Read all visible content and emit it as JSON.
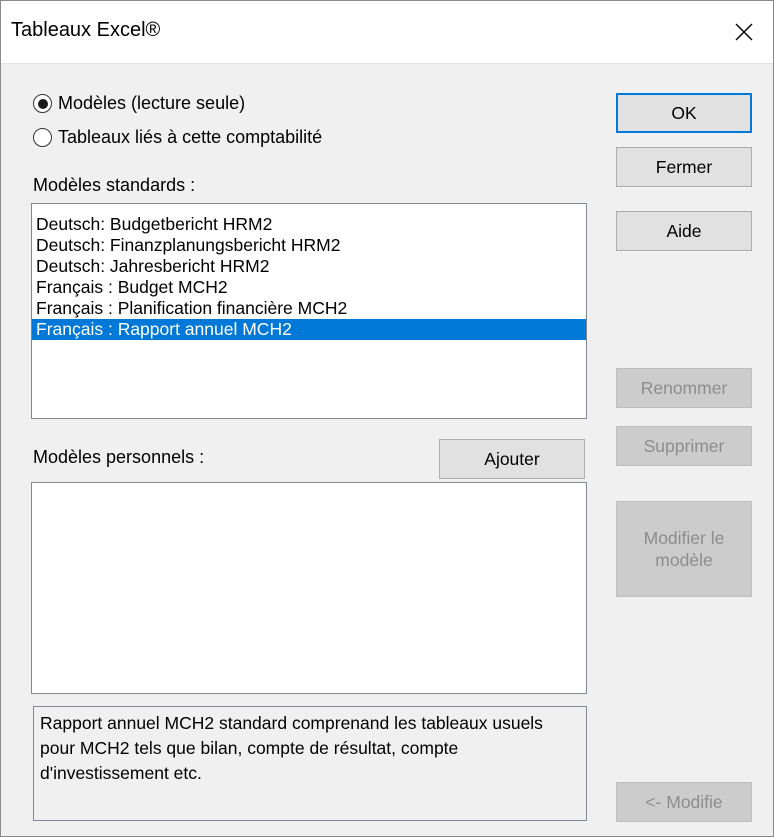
{
  "window": {
    "title": "Tableaux Excel®"
  },
  "mode": {
    "options": [
      {
        "label": "Modèles (lecture seule)",
        "selected": true
      },
      {
        "label": "Tableaux liés à cette comptabilité",
        "selected": false
      }
    ]
  },
  "standard": {
    "label": "Modèles standards :",
    "items": [
      "Deutsch: Budgetbericht HRM2",
      "Deutsch: Finanzplanungsbericht HRM2",
      "Deutsch: Jahresbericht HRM2",
      "Français : Budget MCH2",
      "Français : Planification financière MCH2",
      "Français : Rapport annuel MCH2"
    ],
    "selected_item": "Français : Rapport annuel MCH2"
  },
  "personal": {
    "label": "Modèles personnels :",
    "add_label": "Ajouter",
    "items": []
  },
  "description": "Rapport annuel MCH2 standard comprenand les tableaux usuels pour MCH2 tels que bilan, compte de résultat, compte d'investissement etc.",
  "buttons": {
    "ok": "OK",
    "close": "Fermer",
    "help": "Aide",
    "rename": "Renommer",
    "delete": "Supprimer",
    "edit_line1": "Modifier le",
    "edit_line2": "modèle",
    "modify": "<- Modifie"
  },
  "colors": {
    "selection": "#0078d7",
    "dialog_bg": "#f0f0f0"
  }
}
